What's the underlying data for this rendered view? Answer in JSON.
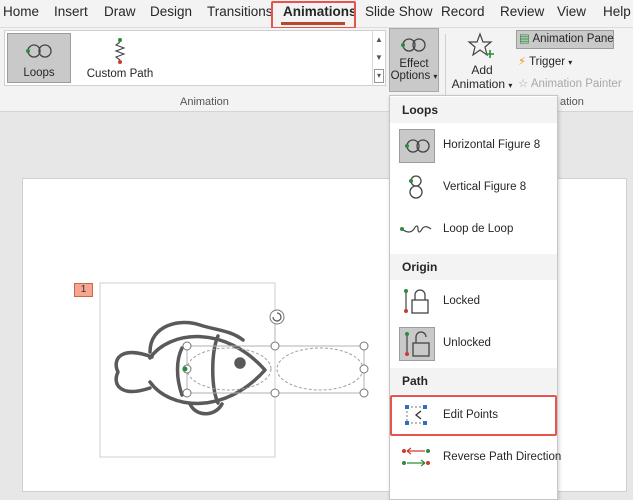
{
  "tabs": [
    "Home",
    "Insert",
    "Draw",
    "Design",
    "Transitions",
    "Animations",
    "Slide Show",
    "Record",
    "Review",
    "View",
    "Help"
  ],
  "ribbon": {
    "gallery_items": [
      "Loops",
      "Custom Path"
    ],
    "animation_group_label": "Animation",
    "effect_options": [
      "Effect",
      "Options"
    ],
    "add_animation": [
      "Add",
      "Animation"
    ],
    "animation_pane": "Animation Pane",
    "trigger": "Trigger",
    "animation_painter": "Animation Painter",
    "advanced_group_label_partial": "ation"
  },
  "slide": {
    "animation_tag": "1"
  },
  "menu": {
    "sections": [
      {
        "header": "Loops",
        "items": [
          "Horizontal Figure 8",
          "Vertical Figure 8",
          "Loop de Loop"
        ]
      },
      {
        "header": "Origin",
        "items": [
          "Locked",
          "Unlocked"
        ]
      },
      {
        "header": "Path",
        "items": [
          "Edit Points",
          "Reverse Path Direction"
        ]
      }
    ]
  },
  "colors": {
    "highlight_border": "#e8534a",
    "tab_underline": "#b7472a",
    "selected_bg": "#c9c9c9",
    "fish_stroke": "#5a5a5a"
  }
}
